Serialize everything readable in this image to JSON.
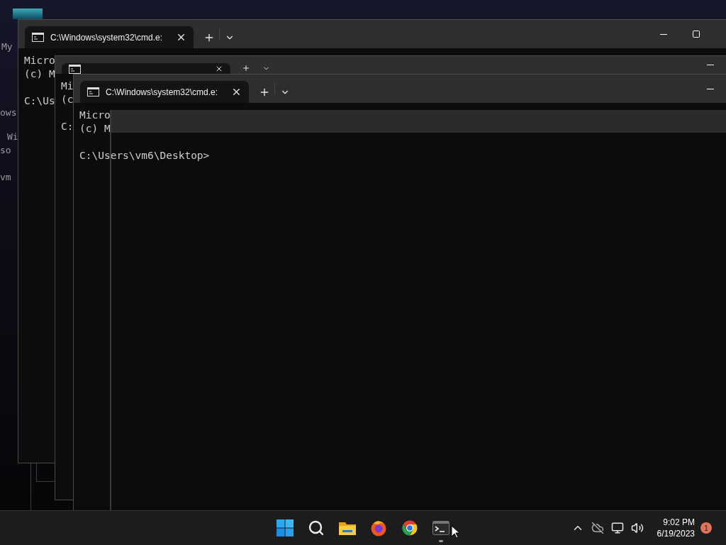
{
  "desktop": {
    "fragments": [
      "My",
      "ows",
      "Wi",
      "so",
      "vm"
    ]
  },
  "windows": [
    {
      "tab_title": "C:\\Windows\\system32\\cmd.e:",
      "blocks": [
        [
          "Micro",
          "(c) M"
        ],
        [
          "C:\\Us"
        ]
      ],
      "buttons": [
        {
          "kind": "minimize"
        },
        {
          "kind": "maximize"
        }
      ]
    },
    {
      "blocks": [
        [
          "Mi",
          "(c"
        ],
        [
          "C:"
        ]
      ],
      "buttons": [
        {
          "kind": "minimize"
        }
      ]
    },
    {
      "tab_title": "C:\\Windows\\system32\\cmd.e:",
      "blocks": [
        [
          "Micro",
          "(c) M"
        ],
        [
          "C:\\Users\\vm6\\Desktop>"
        ]
      ],
      "buttons": [
        {
          "kind": "minimize"
        }
      ]
    }
  ],
  "taskbar": {
    "apps": [
      {
        "kind": "start"
      },
      {
        "kind": "search"
      },
      {
        "kind": "files"
      },
      {
        "kind": "firefox"
      },
      {
        "kind": "chrome"
      },
      {
        "kind": "terminal",
        "running": true
      }
    ],
    "tray": [
      {
        "kind": "chevron"
      },
      {
        "kind": "cloud"
      },
      {
        "kind": "network"
      },
      {
        "kind": "volume"
      }
    ],
    "time": "9:02 PM",
    "date": "6/19/2023",
    "notifications": "1"
  }
}
